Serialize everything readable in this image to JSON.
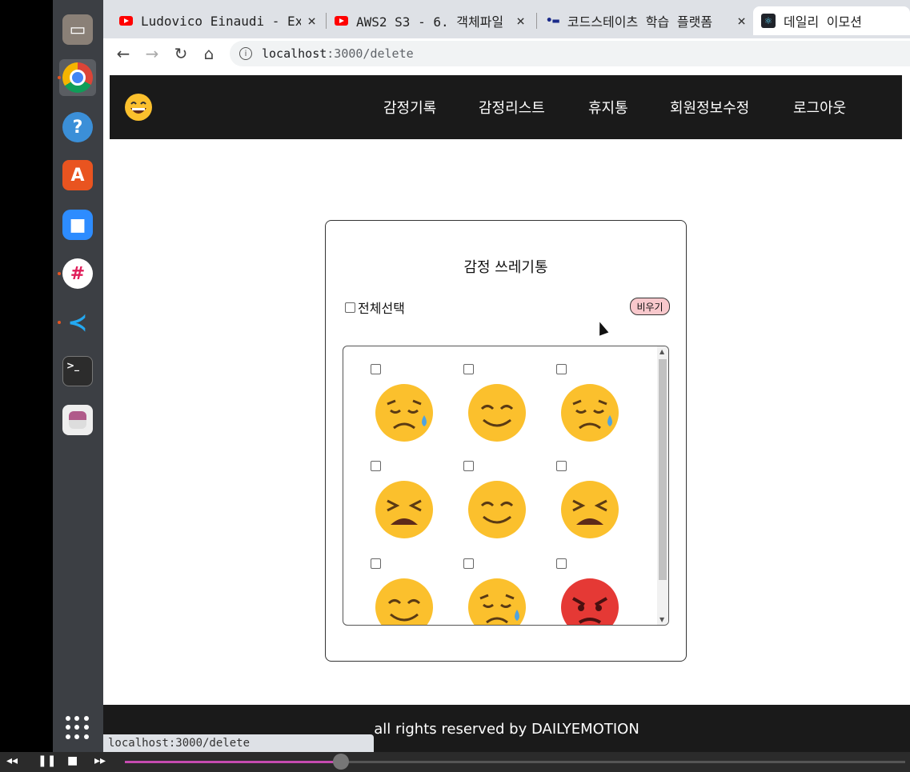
{
  "browser": {
    "tabs": [
      {
        "title": "Ludovico Einaudi - Expe",
        "icon": "youtube-icon"
      },
      {
        "title": "AWS2 S3 - 6. 객체파일 -",
        "icon": "youtube-icon"
      },
      {
        "title": "코드스테이츠 학습 플랫폼",
        "icon": "codestates-icon"
      },
      {
        "title": "데일리 이모션",
        "icon": "react-icon"
      }
    ],
    "url_host": "localhost",
    "url_path": ":3000/delete",
    "status_url": "localhost:3000/delete"
  },
  "site": {
    "nav": [
      "감정기록",
      "감정리스트",
      "휴지통",
      "회원정보수정",
      "로그아웃"
    ],
    "trash": {
      "title": "감정 쓰레기통",
      "select_all": "전체선택",
      "clear_button": "비우기",
      "emotions": [
        "crying",
        "smiling",
        "crying",
        "tired",
        "smiling",
        "tired",
        "smiling",
        "crying",
        "angry"
      ]
    },
    "footer": "all rights reserved by DAILYEMOTION"
  },
  "colors": {
    "nav_bg": "#1a1a1a",
    "clear_button_bg": "#f8c8cc",
    "emoji_yellow": "#fbc02d",
    "emoji_angry": "#e53935"
  }
}
